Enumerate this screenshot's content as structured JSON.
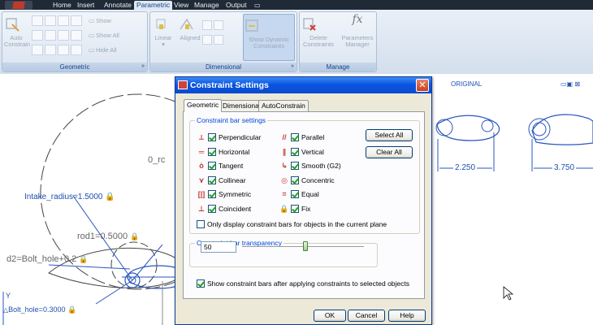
{
  "menubar": {
    "tabs": [
      "Home",
      "Insert",
      "Annotate",
      "Parametric",
      "View",
      "Manage",
      "Output"
    ],
    "active": "Parametric"
  },
  "ribbon": {
    "geometric": {
      "title": "Geometric",
      "auto_label": "Auto",
      "auto_label2": "Constrain",
      "show": "Show",
      "show_all": "Show All",
      "hide_all": "Hide All"
    },
    "dimensional": {
      "title": "Dimensional",
      "linear": "Linear",
      "aligned": "Aligned",
      "show_dynamic": "Show Dynamic",
      "show_dynamic2": "Constraints"
    },
    "manage": {
      "title": "Manage",
      "delete": "Delete",
      "delete2": "Constraints",
      "params": "Parameters",
      "params2": "Manager"
    }
  },
  "canvas": {
    "labels": {
      "original": "ORIGINAL",
      "o_rod": "0_rc",
      "intake": "Intake_radius=1.5000",
      "rod1": "rod1=0.5000",
      "bolt_d2": "d2=Bolt_hole+0.2",
      "bolt_hole": "Bolt_hole=0.3000",
      "dim1": "2.250",
      "dim2": "3.750",
      "axis_y": "Y"
    }
  },
  "dialog": {
    "title": "Constraint Settings",
    "tabs": [
      "Geometric",
      "Dimensional",
      "AutoConstrain"
    ],
    "active_tab": "Geometric",
    "bar_settings_label": "Constraint bar settings",
    "left": [
      {
        "label": "Perpendicular",
        "symbol": "⟂",
        "checked": true
      },
      {
        "label": "Horizontal",
        "symbol": "═",
        "checked": true
      },
      {
        "label": "Tangent",
        "symbol": "ò",
        "checked": true
      },
      {
        "label": "Collinear",
        "symbol": "⋎",
        "checked": true
      },
      {
        "label": "Symmetric",
        "symbol": "[|]",
        "checked": true
      },
      {
        "label": "Coincident",
        "symbol": "⊥",
        "checked": true
      }
    ],
    "right": [
      {
        "label": "Parallel",
        "symbol": "//",
        "checked": true
      },
      {
        "label": "Vertical",
        "symbol": "∥",
        "checked": true
      },
      {
        "label": "Smooth (G2)",
        "symbol": "↳",
        "checked": true
      },
      {
        "label": "Concentric",
        "symbol": "◎",
        "checked": true
      },
      {
        "label": "Equal",
        "symbol": "=",
        "checked": true
      },
      {
        "label": "Fix",
        "symbol": "🔒",
        "checked": true
      }
    ],
    "select_all": "Select All",
    "clear_all": "Clear All",
    "only_current_plane": "Only display constraint bars for objects in the current plane",
    "only_current_plane_checked": false,
    "transparency_label": "Constraint bar transparency",
    "transparency_value": "50",
    "transparency_level": 0.5,
    "show_after": "Show constraint bars after applying constraints to selected objects",
    "show_after_checked": true,
    "ok": "OK",
    "cancel": "Cancel",
    "help": "Help"
  },
  "colors": {
    "accent": "#0a55df",
    "constraint_red": "#c0392b",
    "cad_blue": "#1f4fb0"
  }
}
